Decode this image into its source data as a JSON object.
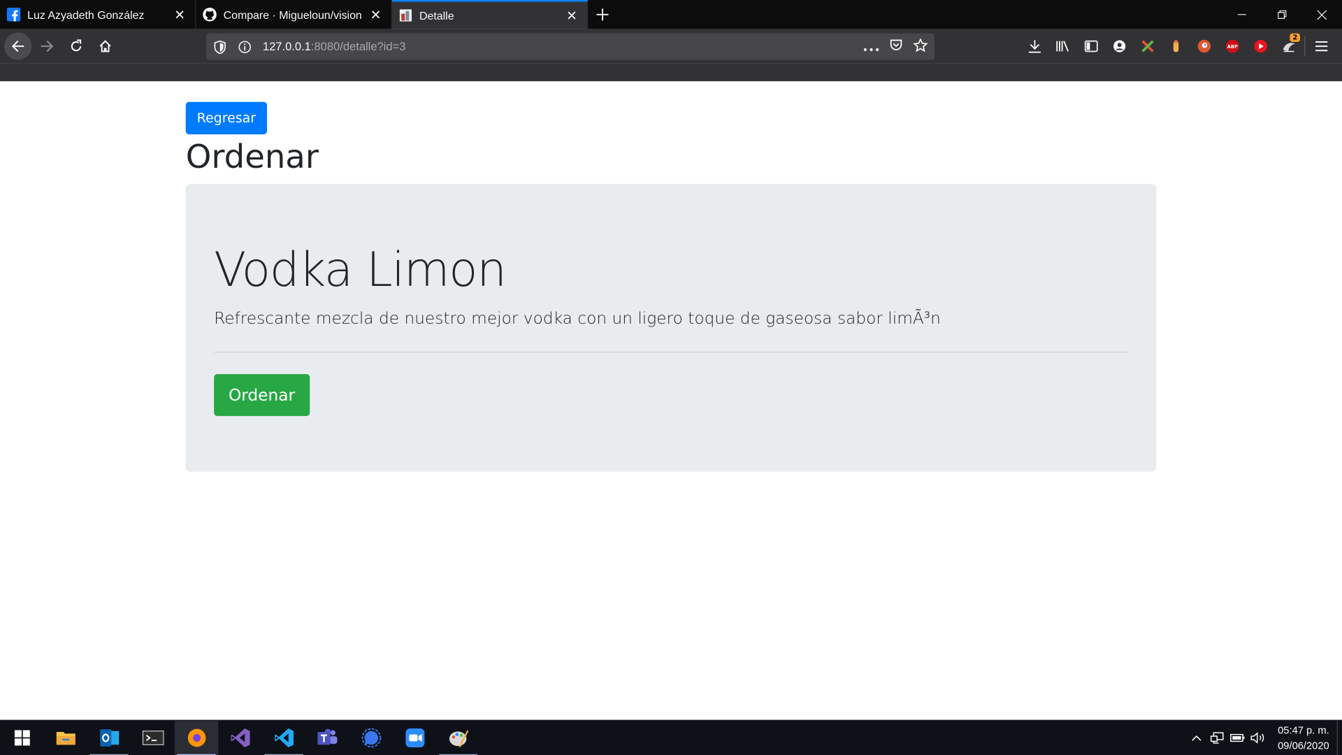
{
  "browser": {
    "tabs": [
      {
        "title": "Luz Azyadeth González",
        "icon": "facebook-icon",
        "active": false
      },
      {
        "title": "Compare · Migueloun/vision",
        "icon": "github-icon",
        "active": false
      },
      {
        "title": "Detalle",
        "icon": "site-favicon",
        "active": true
      }
    ],
    "url_host": "127.0.0.1",
    "url_rest": ":8080/detalle?id=3",
    "toolbar_badge": "2"
  },
  "page": {
    "back_label": "Regresar",
    "title": "Ordenar",
    "product": {
      "name": "Vodka Limon",
      "description": "Refrescante mezcla de nuestro mejor vodka con un ligero toque de gaseosa sabor limÃ³n",
      "order_label": "Ordenar"
    }
  },
  "taskbar": {
    "apps": [
      "windows-start-icon",
      "file-explorer-icon",
      "outlook-icon",
      "terminal-icon",
      "firefox-icon",
      "visual-studio-icon",
      "vscode-icon",
      "teams-icon",
      "signal-icon",
      "zoom-icon",
      "paint-icon"
    ],
    "time": "05:47 p. m.",
    "date": "09/06/2020"
  },
  "colors": {
    "primary": "#007bff",
    "success": "#28a745",
    "jumbotron": "#e9ecef",
    "tab_accent": "#0a84ff"
  }
}
